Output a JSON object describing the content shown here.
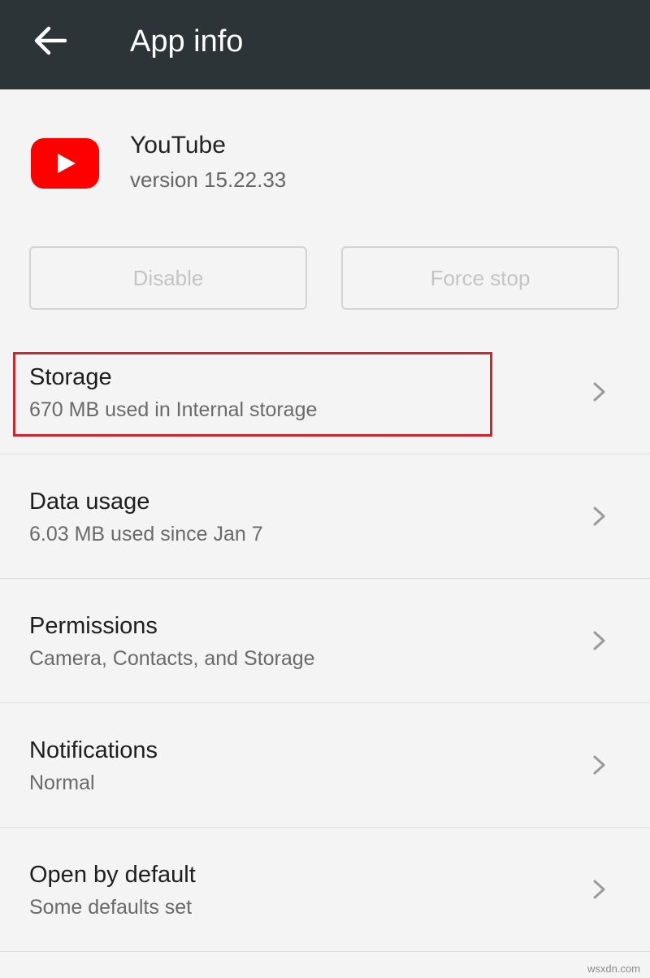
{
  "appbar": {
    "title": "App info"
  },
  "app": {
    "name": "YouTube",
    "version": "version 15.22.33"
  },
  "buttons": {
    "disable": "Disable",
    "force_stop": "Force stop"
  },
  "items": [
    {
      "title": "Storage",
      "subtitle": "670 MB used in Internal storage"
    },
    {
      "title": "Data usage",
      "subtitle": "6.03 MB used since Jan 7"
    },
    {
      "title": "Permissions",
      "subtitle": "Camera, Contacts, and Storage"
    },
    {
      "title": "Notifications",
      "subtitle": "Normal"
    },
    {
      "title": "Open by default",
      "subtitle": "Some defaults set"
    }
  ],
  "watermark": "wsxdn.com",
  "colors": {
    "appbar": "#2d3438",
    "youtube_red": "#ff0000",
    "highlight": "#d0252f"
  },
  "icons": {
    "back": "arrow-left-icon",
    "app": "youtube-logo-icon",
    "chevron": "chevron-right-icon"
  }
}
